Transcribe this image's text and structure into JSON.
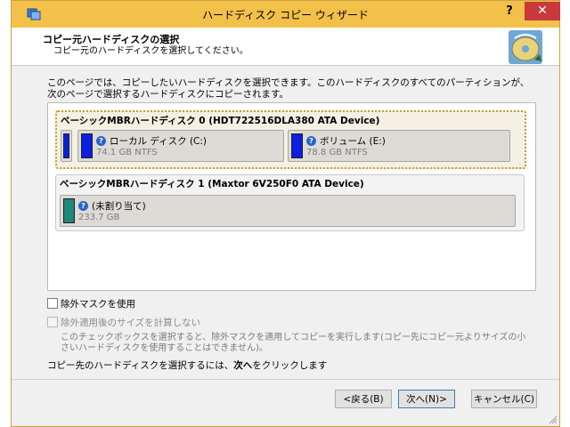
{
  "window": {
    "title": "ハードディスク コピー ウィザード",
    "help": "?",
    "close": "✕"
  },
  "header": {
    "title": "コピー元ハードディスクの選択",
    "subtitle": "コピー元のハードディスクを選択してください。"
  },
  "description": "このページでは、コピーしたいハードディスクを選択できます。このハードディスクのすべてのパーティションが、次のページで選択するハードディスクにコピーされます。",
  "disks": [
    {
      "title": "ベーシックMBRハードディスク 0 (HDT722516DLA380 ATA Device)",
      "selected": true,
      "partitions": [
        {
          "name": "ローカル ディスク (C:)",
          "info": "74.1 GB NTFS",
          "color": "#0a1fe0"
        },
        {
          "name": "ボリューム (E:)",
          "info": "78.8 GB NTFS",
          "color": "#0a1fe0"
        }
      ]
    },
    {
      "title": "ベーシックMBRハードディスク 1 (Maxtor 6V250F0 ATA Device)",
      "selected": false,
      "partitions": [
        {
          "name": "(未割り当て)",
          "info": "233.7 GB",
          "color": "#1f877b"
        }
      ]
    }
  ],
  "options": {
    "exclusion_mask": {
      "label": "除外マスクを使用",
      "checked": false,
      "enabled": true
    },
    "calc_size": {
      "label": "除外適用後のサイズを計算しない",
      "checked": false,
      "enabled": false
    }
  },
  "note": "このチェックボックスを選択すると、除外マスクを適用してコピーを実行します(コピー先にコピー元よりサイズの小さいハードディスクを使用することはできません)。",
  "instruction": {
    "prefix": "コピー先のハードディスクを選択するには、",
    "emphasis": "次へ",
    "suffix": "をクリックします"
  },
  "buttons": {
    "back": "<戻る(B)",
    "next": "次へ(N)>",
    "cancel": "キャンセル(C)"
  },
  "colors": {
    "titlebar": "#f3c04a",
    "close": "#c7393b",
    "partition_bar": "#0a1fe0",
    "unallocated_bar": "#1f877b",
    "selection": "#c79a2c"
  }
}
